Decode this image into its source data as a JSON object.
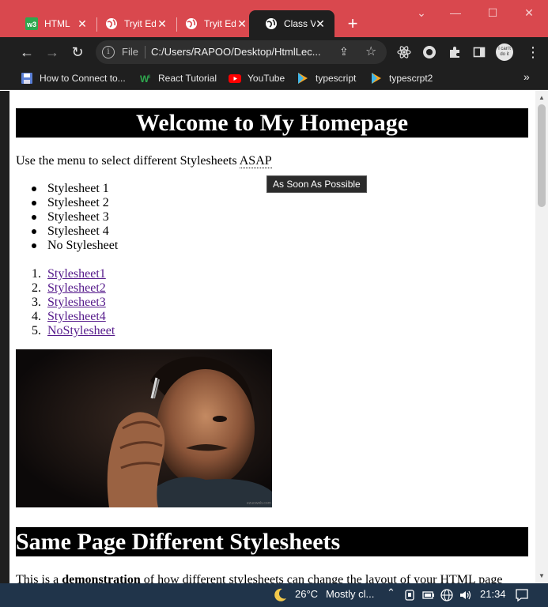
{
  "browser": {
    "tabs": [
      {
        "title": "HTML",
        "icon": "w3-icon"
      },
      {
        "title": "Tryit Ed",
        "icon": "globe-icon"
      },
      {
        "title": "Tryit Ed",
        "icon": "globe-icon"
      },
      {
        "title": "Class V",
        "icon": "globe-icon",
        "active": true
      }
    ],
    "address": {
      "scheme_label": "File",
      "url": "C:/Users/RAPOO/Desktop/HtmlLec..."
    },
    "bookmarks": [
      {
        "label": "How to Connect to...",
        "icon": "floppy-icon"
      },
      {
        "label": "React Tutorial",
        "icon": "w3schools-icon"
      },
      {
        "label": "YouTube",
        "icon": "youtube-icon"
      },
      {
        "label": "typescript",
        "icon": "typescript-icon"
      },
      {
        "label": "typescrpt2",
        "icon": "typescript-icon"
      }
    ],
    "more_label": "»",
    "avatar_text": "I can't do it"
  },
  "page": {
    "heading": "Welcome to My Homepage",
    "intro": {
      "text": "Use the menu to select different Stylesheets ",
      "abbr": "ASAP",
      "tooltip": "As Soon As Possible"
    },
    "unordered": [
      "Stylesheet 1",
      "Stylesheet 2",
      "Stylesheet 3",
      "Stylesheet 4",
      "No Stylesheet"
    ],
    "ordered": [
      {
        "num": "1.",
        "label": "Stylesheet1"
      },
      {
        "num": "2.",
        "label": "Stylesheet2"
      },
      {
        "num": "3.",
        "label": "Stylesheet3"
      },
      {
        "num": "4.",
        "label": "Stylesheet4"
      },
      {
        "num": "5.",
        "label": "NoStylesheet"
      }
    ],
    "image_watermark": "ezuoweb.com",
    "heading2": "Same Page Different Stylesheets",
    "paragraph": {
      "before": "This is a ",
      "bold": "demonstration",
      "after": " of how different stylesheets can change the layout of your HTML page"
    }
  },
  "taskbar": {
    "weather": "26°C",
    "weather_text": "Mostly cl...",
    "time": "21:34"
  },
  "colors": {
    "tab_strip": "#d9484e",
    "toolbar": "#1f1f1f",
    "link": "#551a8b",
    "taskbar": "#20344a"
  }
}
